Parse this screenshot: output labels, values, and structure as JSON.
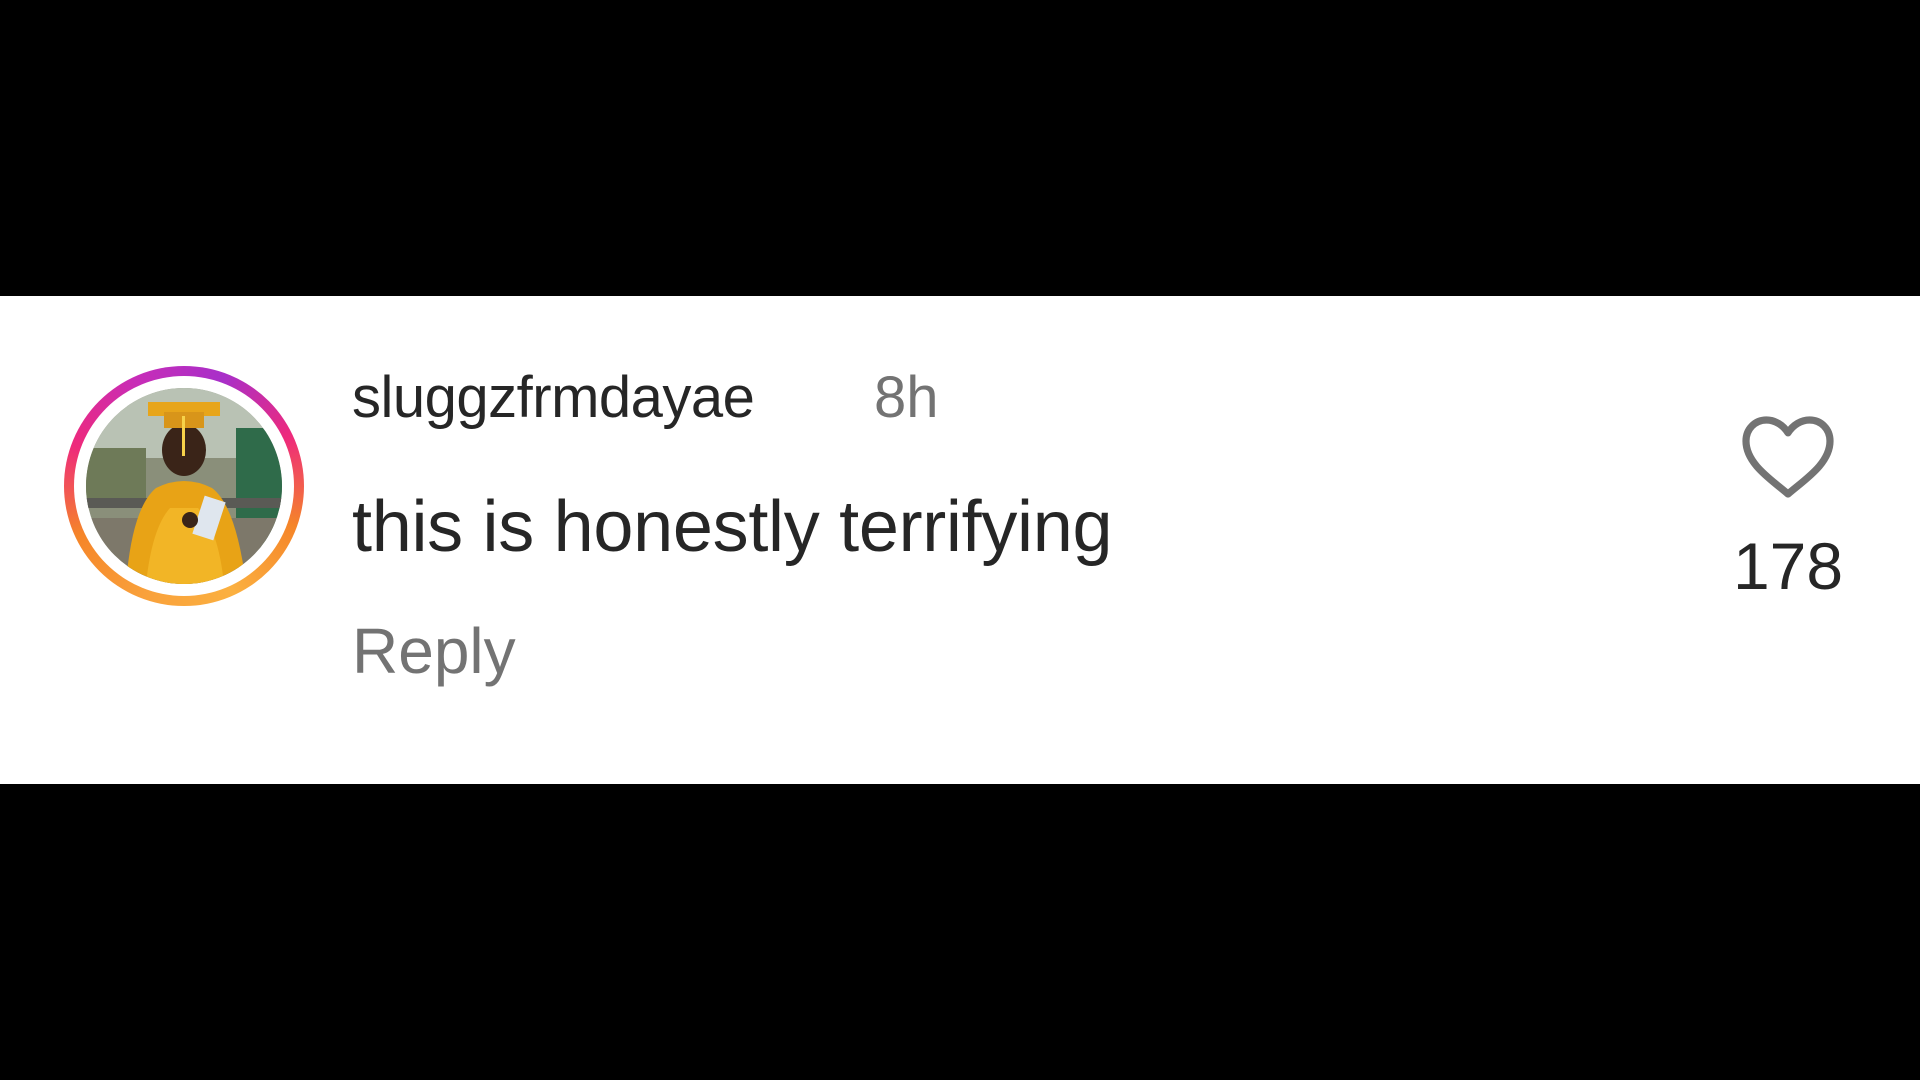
{
  "comment": {
    "username": "sluggzfrmdayae",
    "time_ago": "8h",
    "text": "this is honestly terrifying",
    "reply_label": "Reply",
    "like_count": "178",
    "like_icon": "heart-outline-icon"
  },
  "colors": {
    "background": "#000000",
    "card": "#ffffff",
    "primary_text": "#262626",
    "secondary_text": "#737373",
    "story_ring": [
      "#f58529",
      "#ee2a7b",
      "#c82db7"
    ]
  }
}
